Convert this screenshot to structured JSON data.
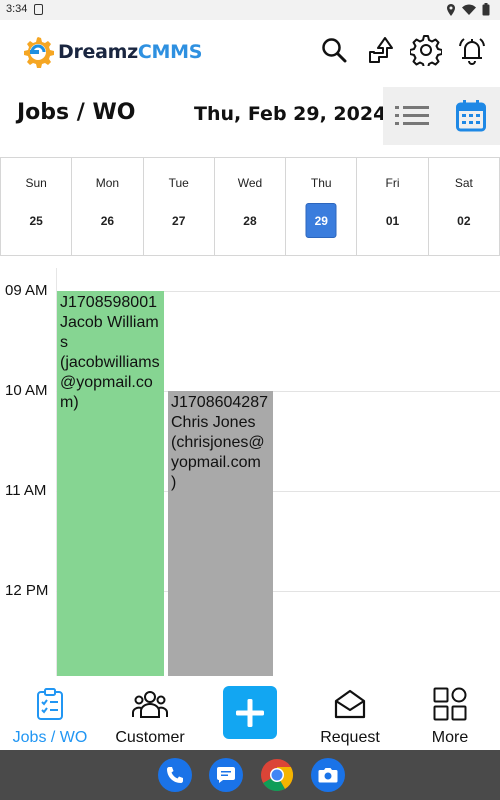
{
  "status_bar": {
    "time": "3:34"
  },
  "app": {
    "brand_primary": "Dreamz",
    "brand_secondary": "CMMS",
    "brand_color": "#2e90e0"
  },
  "header": {
    "icons": [
      "search-icon",
      "switch-arrows-icon",
      "gear-icon",
      "alarm-bell-icon"
    ]
  },
  "page": {
    "title": "Jobs / WO",
    "date": "Thu, Feb 29, 2024",
    "view_modes": [
      "list-view-icon",
      "calendar-view-icon"
    ],
    "active_view": "calendar"
  },
  "week": {
    "days": [
      {
        "name": "Sun",
        "num": "25"
      },
      {
        "name": "Mon",
        "num": "26"
      },
      {
        "name": "Tue",
        "num": "27"
      },
      {
        "name": "Wed",
        "num": "28"
      },
      {
        "name": "Thu",
        "num": "29"
      },
      {
        "name": "Fri",
        "num": "01"
      },
      {
        "name": "Sat",
        "num": "02"
      }
    ],
    "selected_index": 4,
    "selected_color": "#3b7ddd"
  },
  "timeline": {
    "hours": [
      "09 AM",
      "10 AM",
      "11 AM",
      "12 PM"
    ],
    "events": [
      {
        "id": "J1708598001",
        "name": "Jacob Williams",
        "email": "(jacobwilliams@yopmail.com)",
        "color": "#86d592"
      },
      {
        "id": "J1708604287",
        "name": "Chris Jones",
        "email": "(chrisjones@yopmail.com )",
        "color": "#a9a9a9"
      }
    ]
  },
  "bottom_nav": {
    "items": [
      {
        "label": "Jobs / WO",
        "icon": "clipboard-checklist-icon",
        "active": true
      },
      {
        "label": "Customer",
        "icon": "users-group-icon",
        "active": false
      },
      {
        "label": "",
        "icon": "plus-icon",
        "active": false
      },
      {
        "label": "Request",
        "icon": "envelope-open-icon",
        "active": false
      },
      {
        "label": "More",
        "icon": "grid-shapes-icon",
        "active": false
      }
    ],
    "accent_color": "#2196f3",
    "add_button_color": "#12a6f2"
  },
  "system_dock": {
    "apps": [
      "phone-icon",
      "messages-icon",
      "chrome-icon",
      "camera-icon"
    ]
  }
}
